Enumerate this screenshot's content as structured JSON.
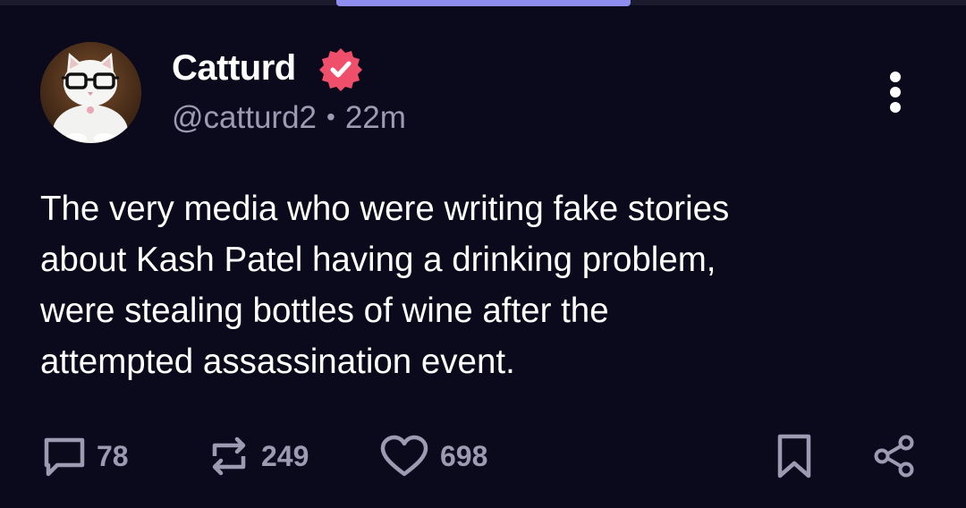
{
  "post": {
    "author": {
      "display_name": "Catturd",
      "handle": "@catturd2",
      "verified": true,
      "avatar": "cat-with-glasses-avatar"
    },
    "separator": "•",
    "time_ago": "22m",
    "text": "The very media who were writing fake stories\nabout Kash Patel having a drinking problem,\nwere stealing bottles of wine after the\nattempted assassination event.",
    "stats": {
      "replies": "78",
      "reposts": "249",
      "likes": "698"
    }
  },
  "icons": {
    "verified": "verified-badge-icon",
    "more": "more-vertical-icon",
    "reply": "speech-bubble-icon",
    "repost": "repost-arrows-icon",
    "like": "heart-outline-icon",
    "bookmark": "bookmark-icon",
    "share": "share-nodes-icon"
  },
  "colors": {
    "background": "#0b0a1c",
    "text": "#ffffff",
    "muted": "#9c9bb2",
    "verified_badge": "#ef4f6a",
    "top_indicator": "#8d8ef0"
  }
}
